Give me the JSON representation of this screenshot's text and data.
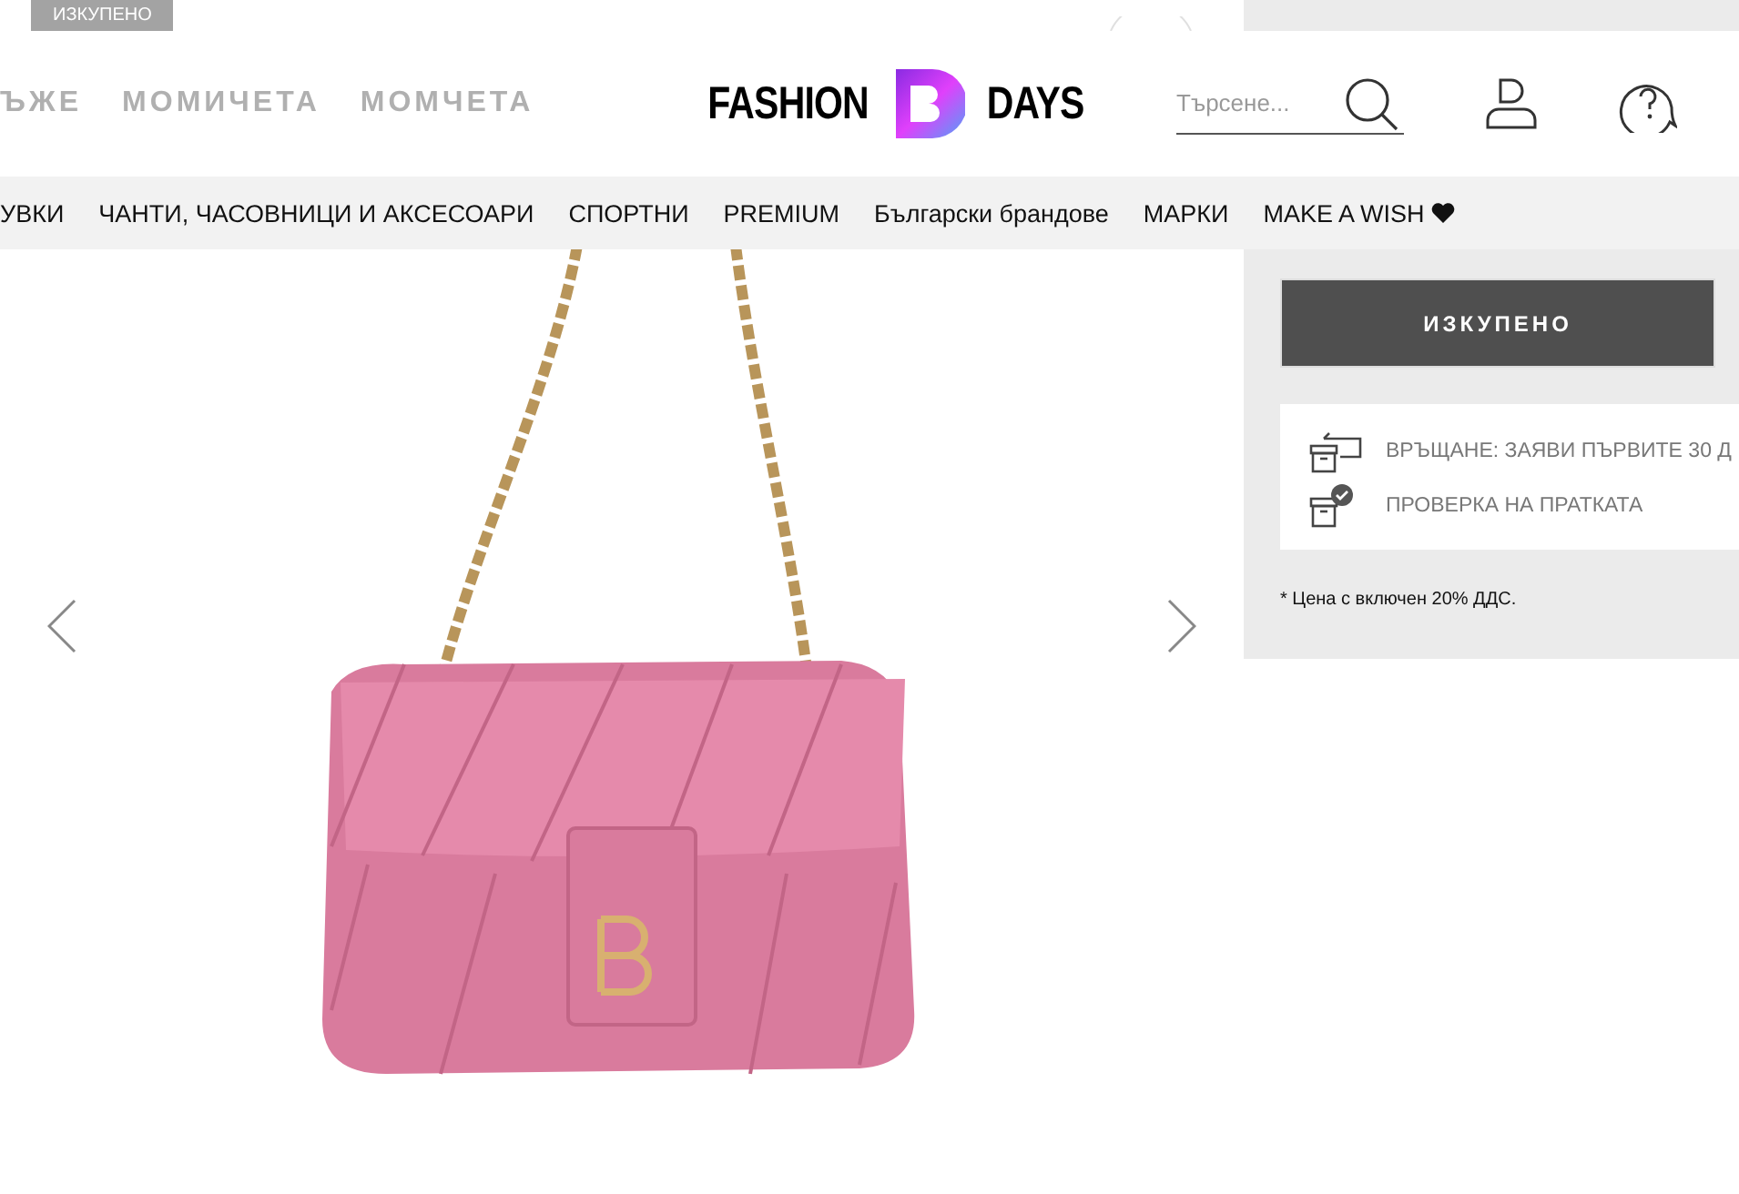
{
  "top_strip": {
    "badge": "ИЗКУПЕНО"
  },
  "header": {
    "categories": [
      "ЪЖЕ",
      "МОМИЧЕТА",
      "МОМЧЕТА"
    ],
    "logo": {
      "left": "FASHION",
      "right": "DAYS"
    },
    "search": {
      "placeholder": "Търсене..."
    }
  },
  "nav": {
    "items": [
      "УВКИ",
      "ЧАНТИ, ЧАСОВНИЦИ И АКСЕСОАРИ",
      "СПОРТНИ",
      "PREMIUM",
      "Български брандове",
      "МАРКИ",
      "MAKE A WISH"
    ]
  },
  "product": {
    "buy_button": "ИЗКУПЕНО",
    "benefits": [
      {
        "kind": "return",
        "text": "ВРЪЩАНЕ: ЗАЯВИ ПЪРВИТЕ 30 Д"
      },
      {
        "kind": "check",
        "text": "ПРОВЕРКА НА ПРАТКАТА"
      }
    ],
    "vat_note": "* Цена с включен 20% ДДС."
  }
}
